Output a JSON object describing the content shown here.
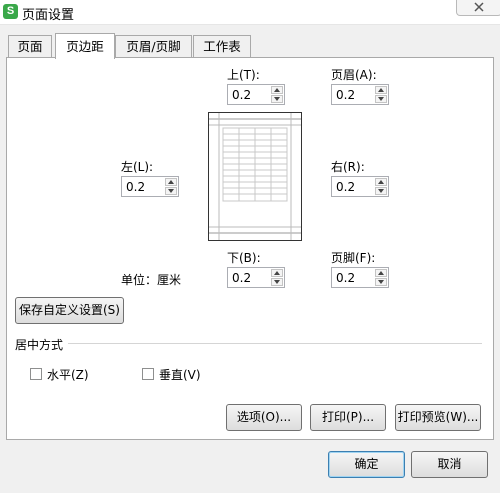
{
  "window": {
    "title": "页面设置",
    "app_icon_letter": "S"
  },
  "tabs": [
    {
      "label": "页面",
      "active": false
    },
    {
      "label": "页边距",
      "active": true
    },
    {
      "label": "页眉/页脚",
      "active": false
    },
    {
      "label": "工作表",
      "active": false
    }
  ],
  "margins": {
    "top": {
      "label": "上(T):",
      "value": "0.2"
    },
    "header": {
      "label": "页眉(A):",
      "value": "0.2"
    },
    "left": {
      "label": "左(L):",
      "value": "0.2"
    },
    "right": {
      "label": "右(R):",
      "value": "0.2"
    },
    "bottom": {
      "label": "下(B):",
      "value": "0.2"
    },
    "footer": {
      "label": "页脚(F):",
      "value": "0.2"
    }
  },
  "units_label": "单位：厘米",
  "save_custom_label": "保存自定义设置(S)",
  "center": {
    "group_label": "居中方式",
    "horizontal": {
      "label": "水平(Z)",
      "checked": false
    },
    "vertical": {
      "label": "垂直(V)",
      "checked": false
    }
  },
  "buttons": {
    "options": "选项(O)...",
    "print": "打印(P)...",
    "print_preview": "打印预览(W)...",
    "ok": "确定",
    "cancel": "取消"
  }
}
